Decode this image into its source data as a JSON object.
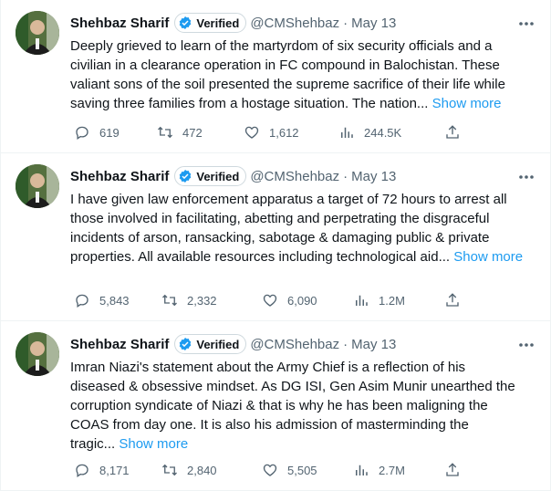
{
  "tweets": [
    {
      "name": "Shehbaz Sharif",
      "verified_label": "Verified",
      "handle": "@CMShehbaz",
      "separator": "·",
      "date": "May 13",
      "lines": [
        "Deeply grieved to learn of the martyrdom of six security officials and a",
        "civilian in a clearance operation in FC compound in Balochistan. These",
        "valiant sons of the soil presented the supreme sacrifice of their life while",
        "saving three families from a hostage situation. The nation..."
      ],
      "show_more": "Show more",
      "replies": "619",
      "retweets": "472",
      "likes": "1,612",
      "views": "244.5K"
    },
    {
      "name": "Shehbaz Sharif",
      "verified_label": "Verified",
      "handle": "@CMShehbaz",
      "separator": "·",
      "date": "May 13",
      "lines": [
        "I have given law enforcement apparatus a target of 72 hours to arrest all",
        "those involved in facilitating, abetting and perpetrating the disgraceful",
        "incidents of arson, ransacking, sabotage & damaging public & private",
        "properties. All available resources including technological aid..."
      ],
      "show_more": "Show more",
      "replies": "5,843",
      "retweets": "2,332",
      "likes": "6,090",
      "views": "1.2M"
    },
    {
      "name": "Shehbaz Sharif",
      "verified_label": "Verified",
      "handle": "@CMShehbaz",
      "separator": "·",
      "date": "May 13",
      "lines": [
        "Imran Niazi's statement about the Army Chief is a reflection of his",
        "diseased & obsessive mindset. As DG ISI, Gen Asim Munir unearthed the",
        "corruption syndicate of Niazi & that is why he has been maligning the",
        "COAS from day one. It is also his admission of masterminding the",
        "tragic..."
      ],
      "show_more": "Show more",
      "replies": "8,171",
      "retweets": "2,840",
      "likes": "5,505",
      "views": "2.7M"
    }
  ],
  "colors": {
    "accent": "#1d9bf0",
    "secondary_text": "#536471",
    "border": "#eff3f4"
  }
}
